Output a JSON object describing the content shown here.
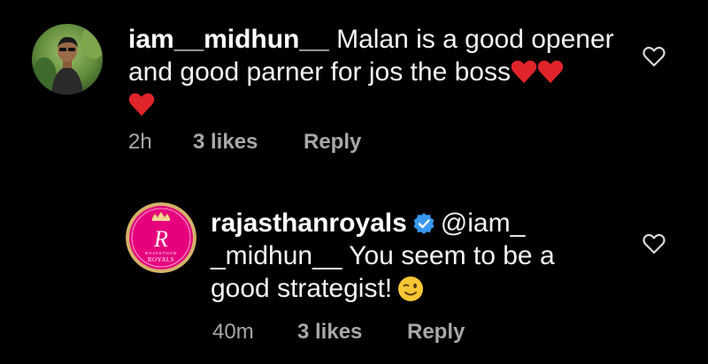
{
  "comments": [
    {
      "username": "iam__midhun__",
      "text_line1": "Malan is a good opener",
      "text_line2": "and good parner for jos the boss",
      "time": "2h",
      "likes": "3 likes",
      "reply": "Reply",
      "avatar_icon": "user-photo-avatar"
    },
    {
      "username": "rajasthanroyals",
      "mention": "@iam_",
      "text_line2": "_midhun__ You seem to be a",
      "text_line3": "good strategist!",
      "time": "40m",
      "likes": "3 likes",
      "reply": "Reply",
      "avatar_icon": "rajasthan-royals-logo",
      "avatar_logo_text": "RAJASTHAN ROYALS"
    }
  ],
  "colors": {
    "background": "#000000",
    "meta_text": "#a8a8a8",
    "heart_emoji": "#e0242b",
    "verified": "#3897f0",
    "royals_pink": "#e6007e",
    "royals_gold": "#c9a24b"
  },
  "icons": [
    "heart-outline-icon",
    "verified-badge-icon",
    "red-heart-emoji",
    "winking-face-emoji"
  ]
}
